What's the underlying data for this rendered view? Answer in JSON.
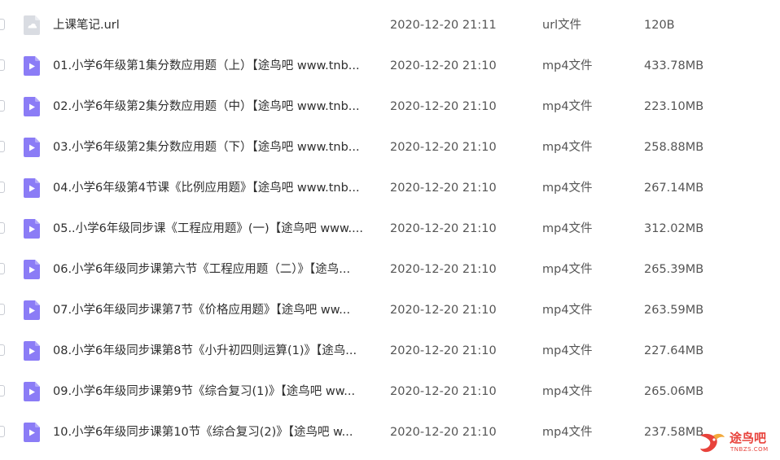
{
  "files": [
    {
      "name": "上课笔记.url",
      "date": "2020-12-20 21:11",
      "type": "url文件",
      "size": "120B",
      "icon": "link-file-icon"
    },
    {
      "name": "01.小学6年级第1集分数应用题（上）【途鸟吧 www.tnb...",
      "date": "2020-12-20 21:10",
      "type": "mp4文件",
      "size": "433.78MB",
      "icon": "video-file-icon"
    },
    {
      "name": "02.小学6年级第2集分数应用题（中）【途鸟吧 www.tnb...",
      "date": "2020-12-20 21:10",
      "type": "mp4文件",
      "size": "223.10MB",
      "icon": "video-file-icon"
    },
    {
      "name": "03.小学6年级第2集分数应用题（下）【途鸟吧 www.tnb...",
      "date": "2020-12-20 21:10",
      "type": "mp4文件",
      "size": "258.88MB",
      "icon": "video-file-icon"
    },
    {
      "name": "04.小学6年级第4节课《比例应用题》【途鸟吧 www.tnb...",
      "date": "2020-12-20 21:10",
      "type": "mp4文件",
      "size": "267.14MB",
      "icon": "video-file-icon"
    },
    {
      "name": "05..小学6年级同步课《工程应用题》(一)【途鸟吧 www....",
      "date": "2020-12-20 21:10",
      "type": "mp4文件",
      "size": "312.02MB",
      "icon": "video-file-icon"
    },
    {
      "name": "06.小学6年级同步课第六节《工程应用题（二）》【途鸟...",
      "date": "2020-12-20 21:10",
      "type": "mp4文件",
      "size": "265.39MB",
      "icon": "video-file-icon"
    },
    {
      "name": "07.小学6年级同步课第7节《价格应用题》【途鸟吧 ww...",
      "date": "2020-12-20 21:10",
      "type": "mp4文件",
      "size": "263.59MB",
      "icon": "video-file-icon"
    },
    {
      "name": "08.小学6年级同步课第8节《小升初四则运算(1)》【途鸟...",
      "date": "2020-12-20 21:10",
      "type": "mp4文件",
      "size": "227.64MB",
      "icon": "video-file-icon"
    },
    {
      "name": "09.小学6年级同步课第9节《综合复习(1)》【途鸟吧 ww...",
      "date": "2020-12-20 21:10",
      "type": "mp4文件",
      "size": "265.06MB",
      "icon": "video-file-icon"
    },
    {
      "name": "10.小学6年级同步课第10节《综合复习(2)》【途鸟吧 w...",
      "date": "2020-12-20 21:10",
      "type": "mp4文件",
      "size": "237.58MB",
      "icon": "video-file-icon"
    }
  ],
  "watermark": {
    "text": "途鸟吧",
    "sub": "TNBZS.COM"
  },
  "colors": {
    "video_icon": "#8b7cf6",
    "link_icon": "#d9dce2",
    "watermark": "#e8423b"
  }
}
